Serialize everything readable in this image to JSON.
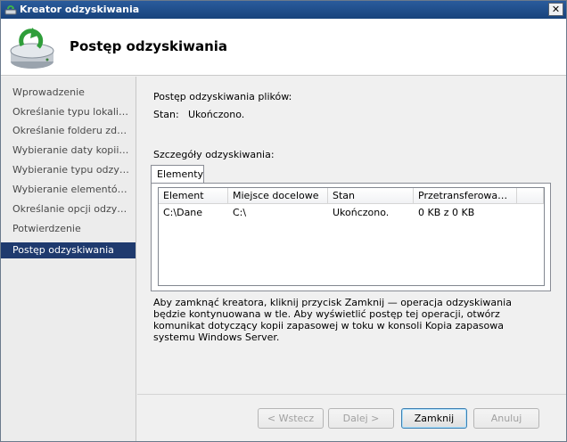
{
  "window": {
    "title": "Kreator odzyskiwania",
    "close_glyph": "✕"
  },
  "header": {
    "title": "Postęp odzyskiwania"
  },
  "sidebar": {
    "items": [
      {
        "label": "Wprowadzenie",
        "active": false
      },
      {
        "label": "Określanie typu lokalizacji",
        "active": false
      },
      {
        "label": "Określanie folderu zdal...",
        "active": false
      },
      {
        "label": "Wybieranie daty kopii z...",
        "active": false
      },
      {
        "label": "Wybieranie typu odzys...",
        "active": false
      },
      {
        "label": "Wybieranie elementów...",
        "active": false
      },
      {
        "label": "Określanie opcji odzysk...",
        "active": false
      },
      {
        "label": "Potwierdzenie",
        "active": false
      },
      {
        "label": "Postęp odzyskiwania",
        "active": true
      }
    ]
  },
  "progress": {
    "heading": "Postęp odzyskiwania plików:",
    "status_label": "Stan:",
    "status_value": "Ukończono."
  },
  "details": {
    "heading": "Szczegóły odzyskiwania:",
    "tab_label": "Elementy",
    "columns": [
      "Element",
      "Miejsce docelowe",
      "Stan",
      "Przetransferowan..."
    ],
    "rows": [
      [
        "C:\\Dane",
        "C:\\",
        "Ukończono.",
        "0 KB z 0 KB"
      ]
    ]
  },
  "note": "Aby zamknąć kreatora, kliknij przycisk Zamknij — operacja odzyskiwania będzie kontynuowana w tle. Aby wyświetlić postęp tej operacji, otwórz komunikat dotyczący kopii zapasowej w toku w konsoli Kopia zapasowa systemu Windows Server.",
  "buttons": {
    "back": "< Wstecz",
    "next": "Dalej >",
    "close": "Zamknij",
    "cancel": "Anuluj"
  },
  "icons": {
    "app": "restore-wizard-icon",
    "header": "disk-restore-icon"
  },
  "colors": {
    "titlebar": "#1f4c8a",
    "active_step": "#1f3a6e"
  }
}
